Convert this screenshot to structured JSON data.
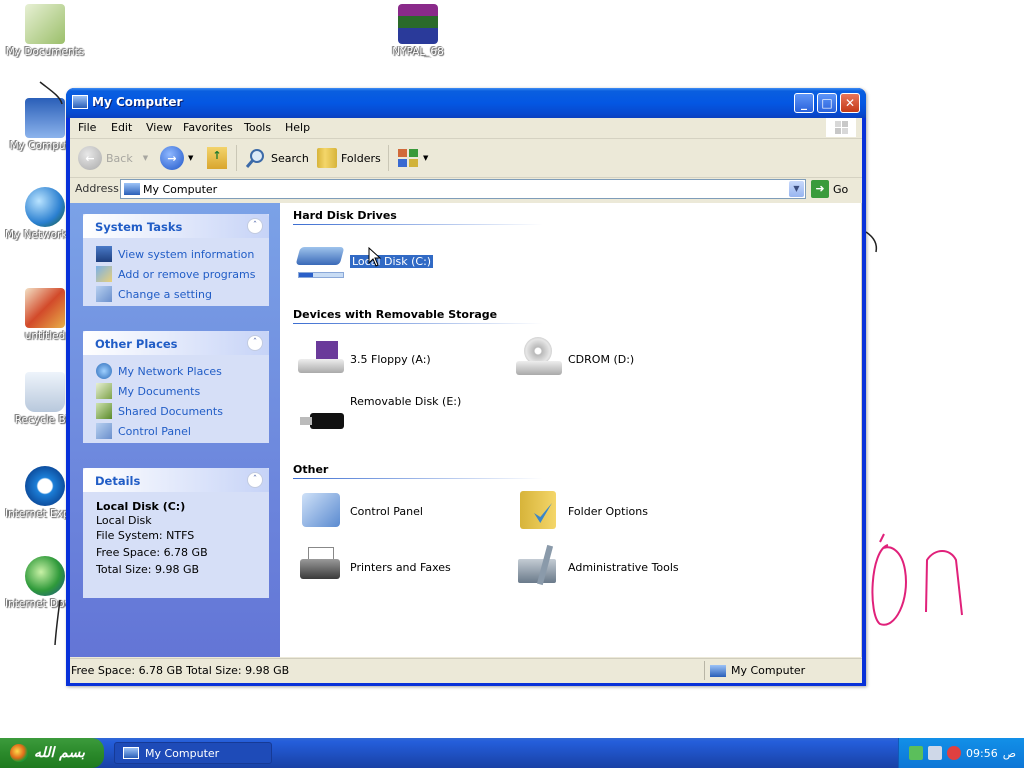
{
  "desktop": {
    "icons": [
      {
        "label": "My Documents"
      },
      {
        "label": "NYPAL_68"
      },
      {
        "label": "My Computer"
      },
      {
        "label": "My Network Places"
      },
      {
        "label": "untitled"
      },
      {
        "label": "Recycle Bin"
      },
      {
        "label": "Internet Explorer"
      },
      {
        "label": "Internet Download Manager"
      }
    ],
    "scribble_text": "On"
  },
  "window": {
    "title": "My Computer",
    "controls": {
      "minimize": "_",
      "maximize": "□",
      "close": "✕"
    },
    "menu": [
      "File",
      "Edit",
      "View",
      "Favorites",
      "Tools",
      "Help"
    ],
    "toolbar": {
      "back": "Back",
      "search": "Search",
      "folders": "Folders"
    },
    "address": {
      "label": "Address",
      "value": "My Computer",
      "go": "Go"
    },
    "left_pane": {
      "system_tasks": {
        "title": "System Tasks",
        "items": [
          "View system information",
          "Add or remove programs",
          "Change a setting"
        ]
      },
      "other_places": {
        "title": "Other Places",
        "items": [
          "My Network Places",
          "My Documents",
          "Shared Documents",
          "Control Panel"
        ]
      },
      "details": {
        "title": "Details",
        "name": "Local Disk (C:)",
        "type": "Local Disk",
        "file_system": "File System: NTFS",
        "free_space": "Free Space: 6.78 GB",
        "total_size": "Total Size: 9.98 GB"
      }
    },
    "content": {
      "groups": {
        "hard_disk": "Hard Disk Drives",
        "removable": "Devices with Removable Storage",
        "other": "Other"
      },
      "hard_disk_items": [
        {
          "label": "Local Disk (C:)",
          "selected": true,
          "used_fraction": 0.32
        }
      ],
      "removable_items": [
        {
          "label": "3.5 Floppy (A:)"
        },
        {
          "label": "CDROM (D:)"
        },
        {
          "label": "Removable Disk (E:)"
        }
      ],
      "other_items": [
        {
          "label": "Control Panel"
        },
        {
          "label": "Folder Options"
        },
        {
          "label": "Printers and Faxes"
        },
        {
          "label": "Administrative Tools"
        }
      ]
    },
    "status": {
      "left": "Free Space: 6.78 GB Total Size: 9.98 GB",
      "right": "My Computer"
    }
  },
  "taskbar": {
    "start_label": "بسم الله",
    "tasks": [
      {
        "label": "My Computer"
      }
    ],
    "clock": "09:56",
    "clock_suffix": "ص"
  },
  "colors": {
    "title_blue": "#0457e3",
    "task_link_blue": "#215dc6",
    "selection": "#316ac5",
    "start_green": "#2b8a2b",
    "scribble_pink": "#e0217a"
  }
}
